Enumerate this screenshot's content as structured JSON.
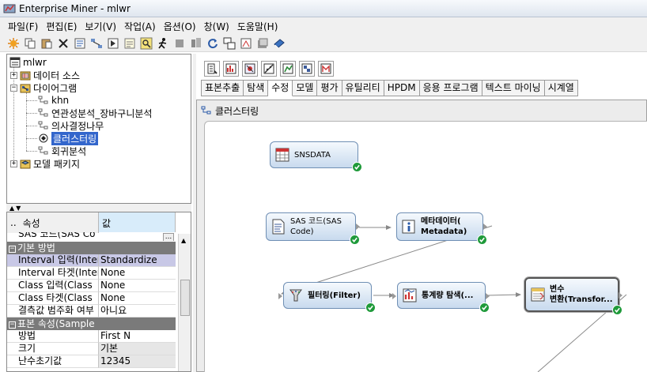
{
  "window": {
    "title": "Enterprise Miner - mlwr"
  },
  "menu": [
    "파일(F)",
    "편집(E)",
    "보기(V)",
    "작업(A)",
    "옵션(O)",
    "창(W)",
    "도움말(H)"
  ],
  "toolbar_icons": [
    "new-icon",
    "copy-icon",
    "paste-icon",
    "delete-icon",
    "properties-icon",
    "diagram-icon",
    "run-icon",
    "results-icon",
    "find-icon",
    "run-person-icon",
    "stop-icon",
    "reports-icon",
    "refresh-icon",
    "layout-icon",
    "model-compare-icon",
    "export-icon",
    "help-book-icon"
  ],
  "tree": {
    "root": "mlwr",
    "data_sources": "데이터 소스",
    "diagrams": "다이어그램",
    "diagram_items": [
      "khn",
      "연관성분석_장바구니분석",
      "의사결정나무",
      "클러스터링",
      "회귀분석"
    ],
    "selected_item": "클러스터링",
    "model_packages": "모델 패키지"
  },
  "properties": {
    "col_property": "속성",
    "col_value": "값",
    "top_clipped": "SAS 코드(SAS Co",
    "rows": [
      {
        "kind": "group",
        "name": "기본 방법"
      },
      {
        "kind": "row",
        "name": "Interval 입력(Inter",
        "value": "Standardize",
        "highlight": true
      },
      {
        "kind": "row",
        "name": "Interval 타겟(Inter",
        "value": "None"
      },
      {
        "kind": "row",
        "name": "Class 입력(Class",
        "value": "None"
      },
      {
        "kind": "row",
        "name": "Class 타겟(Class",
        "value": "None"
      },
      {
        "kind": "row",
        "name": "결측값 범주화 여부",
        "value": "아니요"
      },
      {
        "kind": "group",
        "name": "표본 속성(Sample"
      },
      {
        "kind": "row",
        "name": "방법",
        "value": "First N"
      },
      {
        "kind": "row",
        "name": "크기",
        "value": "기본",
        "gray": true
      },
      {
        "kind": "row",
        "name": "난수초기값",
        "value": "12345",
        "gray": true
      }
    ]
  },
  "tool_icons": [
    "sample-tool-icon",
    "explore-tool-icon",
    "modify-tool-icon",
    "model-tool-icon",
    "assess-tool-icon",
    "utility-tool-icon",
    "hpdm-tool-icon"
  ],
  "tabs": [
    "표본추출",
    "탐색",
    "수정",
    "모델",
    "평가",
    "유틸리티",
    "HPDM",
    "응용 프로그램",
    "텍스트 마이닝",
    "시계열"
  ],
  "active_tab": "수정",
  "diagram": {
    "title": "클러스터링",
    "nodes": [
      {
        "id": "snsdata",
        "label": "SNSDATA",
        "icon": "data-source-icon"
      },
      {
        "id": "sascode",
        "label": "SAS 코드(SAS\nCode)",
        "icon": "sas-code-icon"
      },
      {
        "id": "metadata",
        "label": "메타데이터(\nMetadata)",
        "icon": "metadata-icon"
      },
      {
        "id": "filter",
        "label": "필터링(Filter)",
        "icon": "filter-icon"
      },
      {
        "id": "stat",
        "label": "통계량 탐색(...",
        "icon": "stat-explore-icon"
      },
      {
        "id": "transform",
        "label": "변수\n변환(Transfor...",
        "icon": "transform-icon"
      }
    ]
  },
  "colors": {
    "node_border": "#6f8fb4",
    "success_badge": "#1f9a3a",
    "selection": "#3366cc"
  }
}
